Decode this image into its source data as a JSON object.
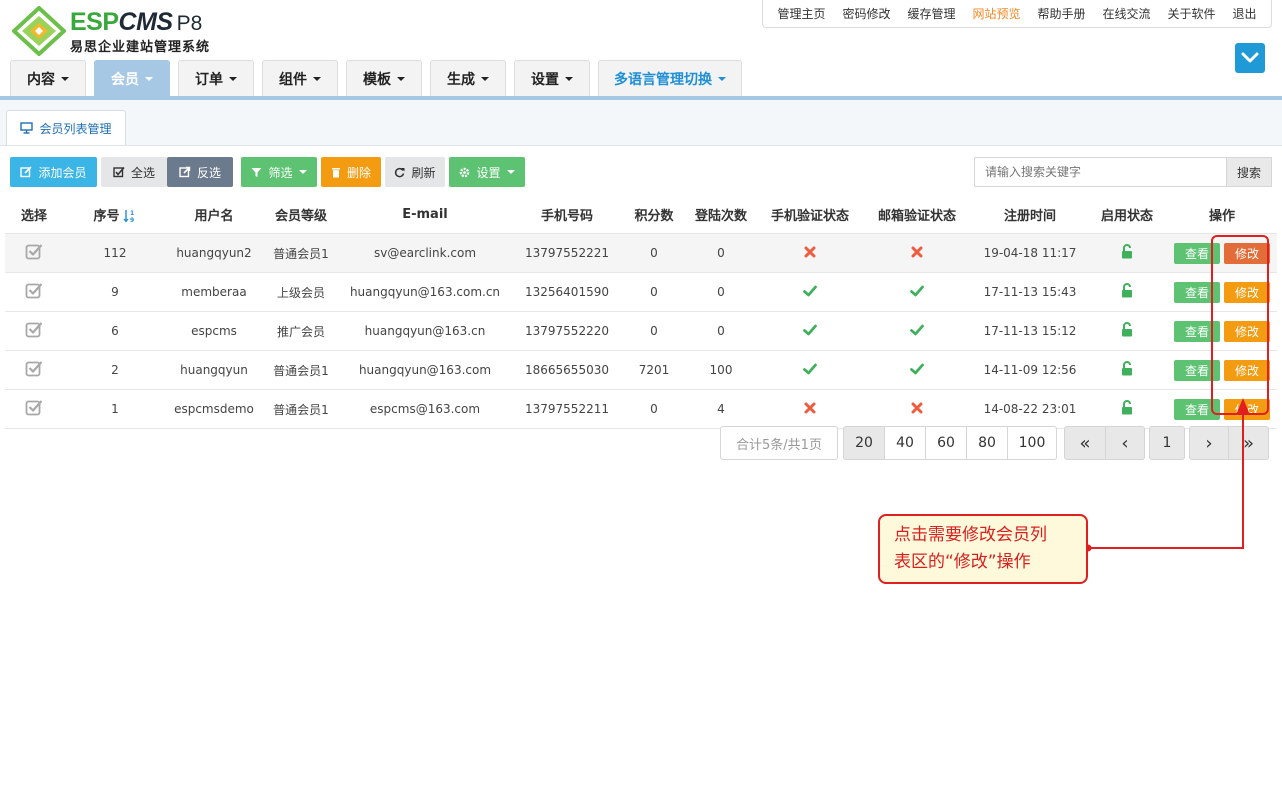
{
  "brand": {
    "name_a": "ESP",
    "name_b": "CMS",
    "version": "P8",
    "subtitle": "易思企业建站管理系统"
  },
  "top_links": [
    {
      "label": "管理主页",
      "active": false
    },
    {
      "label": "密码修改",
      "active": false
    },
    {
      "label": "缓存管理",
      "active": false
    },
    {
      "label": "网站预览",
      "active": true
    },
    {
      "label": "帮助手册",
      "active": false
    },
    {
      "label": "在线交流",
      "active": false
    },
    {
      "label": "关于软件",
      "active": false
    },
    {
      "label": "退出",
      "active": false
    }
  ],
  "main_nav": [
    {
      "label": "内容"
    },
    {
      "label": "会员"
    },
    {
      "label": "订单"
    },
    {
      "label": "组件"
    },
    {
      "label": "模板"
    },
    {
      "label": "生成"
    },
    {
      "label": "设置"
    },
    {
      "label": "多语言管理切换"
    }
  ],
  "page_tab": {
    "label": "会员列表管理"
  },
  "toolbar": {
    "add": "添加会员",
    "select_all": "全选",
    "invert": "反选",
    "filter": "筛选",
    "delete": "删除",
    "refresh": "刷新",
    "settings": "设置"
  },
  "search": {
    "placeholder": "请输入搜索关键字",
    "button": "搜索"
  },
  "table": {
    "headers": {
      "select": "选择",
      "id": "序号",
      "username": "用户名",
      "level": "会员等级",
      "email": "E-mail",
      "phone": "手机号码",
      "points": "积分数",
      "logins": "登陆次数",
      "phone_verified": "手机验证状态",
      "email_verified": "邮箱验证状态",
      "registered": "注册时间",
      "enabled": "启用状态",
      "actions": "操作"
    },
    "view_label": "查看",
    "edit_label": "修改",
    "rows": [
      {
        "id": "112",
        "username": "huangqyun2",
        "level": "普通会员1",
        "email": "sv@earclink.com",
        "phone": "13797552221",
        "points": "0",
        "logins": "0",
        "phone_verified": false,
        "email_verified": false,
        "registered": "19-04-18 11:17"
      },
      {
        "id": "9",
        "username": "memberaa",
        "level": "上级会员",
        "email": "huangqyun@163.com.cn",
        "phone": "13256401590",
        "points": "0",
        "logins": "0",
        "phone_verified": true,
        "email_verified": true,
        "registered": "17-11-13 15:43"
      },
      {
        "id": "6",
        "username": "espcms",
        "level": "推广会员",
        "email": "huangqyun@163.cn",
        "phone": "13797552220",
        "points": "0",
        "logins": "0",
        "phone_verified": true,
        "email_verified": true,
        "registered": "17-11-13 15:12"
      },
      {
        "id": "2",
        "username": "huangqyun",
        "level": "普通会员1",
        "email": "huangqyun@163.com",
        "phone": "18665655030",
        "points": "7201",
        "logins": "100",
        "phone_verified": true,
        "email_verified": true,
        "registered": "14-11-09 12:56"
      },
      {
        "id": "1",
        "username": "espcmsdemo",
        "level": "普通会员1",
        "email": "espcms@163.com",
        "phone": "13797552211",
        "points": "0",
        "logins": "4",
        "phone_verified": false,
        "email_verified": false,
        "registered": "14-08-22 23:01"
      }
    ]
  },
  "pagination": {
    "summary": "合计5条/共1页",
    "page_sizes": [
      "20",
      "40",
      "60",
      "80",
      "100"
    ],
    "current_page": "1",
    "first": "«",
    "prev": "‹",
    "next": "›",
    "last": "»"
  },
  "annotation": {
    "line1": "点击需要修改会员列",
    "line2": "表区的“修改”操作"
  },
  "colors": {
    "accent_blue": "#3bb4e6",
    "nav_active": "#a7c8e4",
    "green": "#5dc373",
    "orange": "#f39c12",
    "red": "#e02020"
  }
}
